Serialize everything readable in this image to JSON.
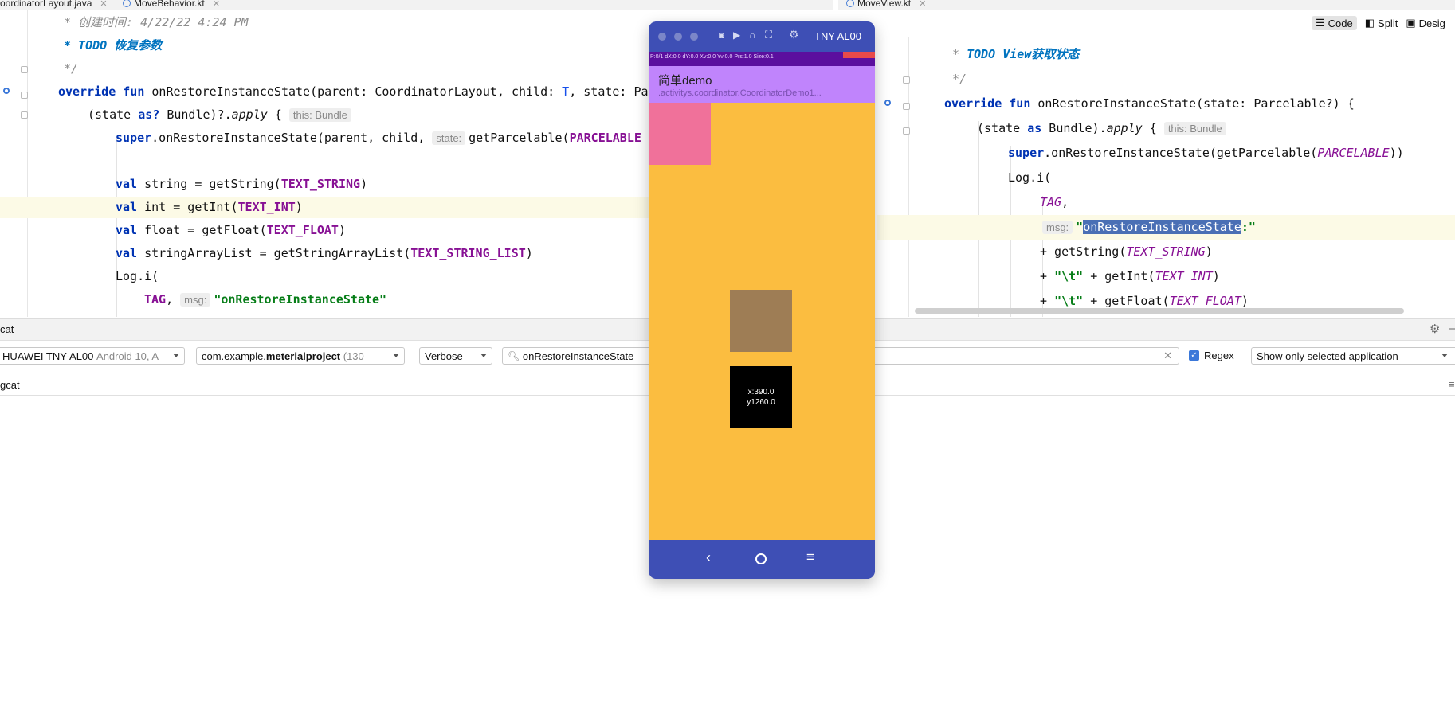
{
  "tabs_left": [
    {
      "label": "oordinatorLayout.java"
    },
    {
      "label": "MoveBehavior.kt"
    }
  ],
  "tabs_right": [
    {
      "label": "MoveView.kt"
    }
  ],
  "view_modes": {
    "code": "Code",
    "split": "Split",
    "design": "Desig"
  },
  "left_editor": {
    "l1": "* 创建时间: 4/22/22 4:24 PM",
    "l2_todo": "* TODO",
    "l2_text": " 恢复参数",
    "l3": "*/",
    "l4_a": "override fun ",
    "l4_b": "onRestoreInstanceState(parent: CoordinatorLayout, child: ",
    "l4_t": "T",
    "l4_c": ", state: Par",
    "l5_a": "(state ",
    "l5_kw": "as?",
    "l5_b": " Bundle)?.",
    "l5_apply": "apply",
    "l5_c": " {",
    "l5_hint": "this: Bundle",
    "l6_kw": "super",
    "l6_a": ".onRestoreInstanceState(parent, child, ",
    "l6_hint": "state:",
    "l6_b": "getParcelable(",
    "l6_const": "PARCELABLE",
    "l7_kw": "val",
    "l7_a": " string = getString(",
    "l7_const": "TEXT_STRING",
    "l7_b": ")",
    "l8_kw": "val",
    "l8_a": " int = getInt(",
    "l8_const": "TEXT_INT",
    "l8_b": ")",
    "l9_kw": "val",
    "l9_a": " float = getFloat(",
    "l9_const": "TEXT_FLOAT",
    "l9_b": ")",
    "l10_kw": "val",
    "l10_a": " stringArrayList = getStringArrayList(",
    "l10_const": "TEXT_STRING_LIST",
    "l10_b": ")",
    "l11": "Log.i(",
    "l12_const": "TAG",
    "l12_a": ", ",
    "l12_hint": "msg:",
    "l12_str": "\"onRestoreInstanceState\""
  },
  "right_editor": {
    "r1_a": "* ",
    "r1_todo": "TODO View获取状态",
    "r2": "*/",
    "r3_a": "override fun ",
    "r3_b": "onRestoreInstanceState(state: Parcelable?) {",
    "r4_a": "(state ",
    "r4_kw": "as",
    "r4_b": " Bundle).",
    "r4_apply": "apply",
    "r4_c": " {",
    "r4_hint": "this: Bundle",
    "r5_kw": "super",
    "r5_a": ".onRestoreInstanceState(getParcelable(",
    "r5_const": "PARCELABLE",
    "r5_b": "))",
    "r6": "Log.i(",
    "r7_const": "TAG",
    "r7_b": ",",
    "r8_hint": "msg:",
    "r8_q1": "\"",
    "r8_sel": "onRestoreInstanceState",
    "r8_q2": ":\"",
    "r9_a": "+ getString(",
    "r9_const": "TEXT_STRING",
    "r9_b": ")",
    "r10_a": "+ ",
    "r10_str": "\"\\t\"",
    "r10_b": " + getInt(",
    "r10_const": "TEXT_INT",
    "r10_c": ")",
    "r11_a": "+ ",
    "r11_str": "\"\\t\"",
    "r11_b": " + getFloat(",
    "r11_const": "TEXT FLOAT",
    "r11_c": ")"
  },
  "logcat": {
    "panel_title": "cat",
    "device": "HUAWEI TNY-AL00",
    "device_os": "Android 10, A",
    "package_prefix": "com.example.",
    "package_bold": "meterialproject",
    "package_pid": "(130",
    "level": "Verbose",
    "search_value": "onRestoreInstanceState",
    "regex_label": "Regex",
    "regex_checked": true,
    "filter": "Show only selected application",
    "tab_label": "gcat"
  },
  "emulator": {
    "device_name": "TNY AL00",
    "statusbar_text": "P:0/1   dX:0.0   dY:0.0   Xv:0.0   Yv:0.0   Prs:1.0   Size:0.1",
    "app_title": "简单demo",
    "app_subtitle": ".activitys.coordinator.CoordinatorDemo1...",
    "box_text_x": "x:390.0",
    "box_text_y": "y1260.0",
    "colors": {
      "content_bg": "#fbbd40",
      "appbar_bg": "#c084fc",
      "pink_box": "#f0719a",
      "brown_box": "#9e7d55",
      "black_box": "#000000",
      "navbar_bg": "#3e4fb5"
    }
  }
}
